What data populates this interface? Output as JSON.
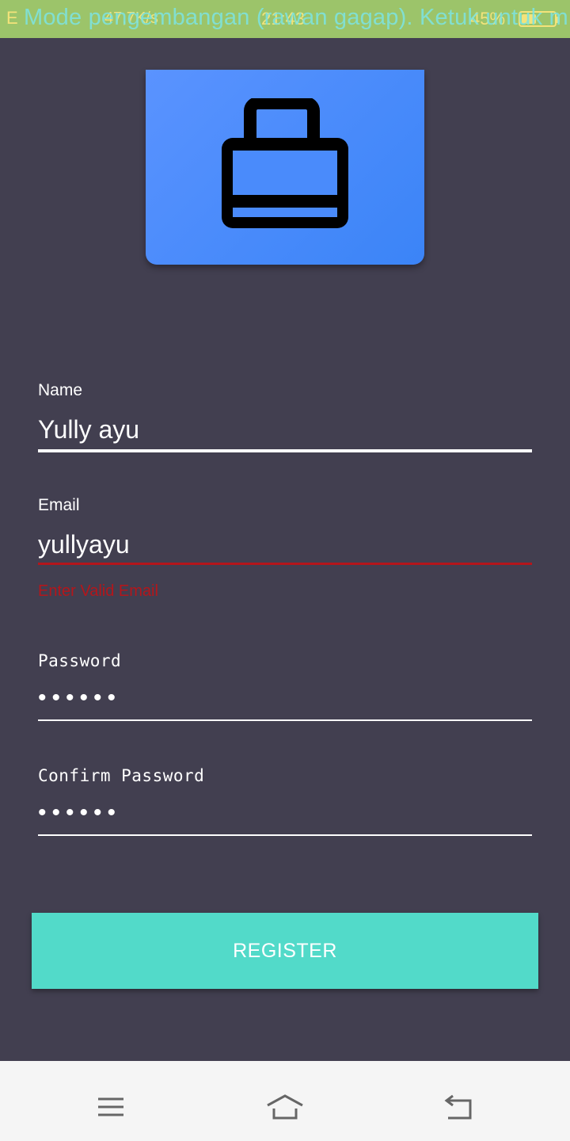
{
  "status_bar": {
    "left_text": "E",
    "network_speed": "47,7K/s",
    "time": "21:43",
    "battery_percent": "45%",
    "battery_level": 0.45,
    "dev_banner": "Mode pengembangan (rawan gagap). Ketuk untuk m..."
  },
  "logo": {
    "icon": "briefcase-icon",
    "color": "#3b84f7"
  },
  "form": {
    "name": {
      "label": "Name",
      "value": "Yully ayu"
    },
    "email": {
      "label": "Email",
      "value": "yullyayu",
      "error": "Enter Valid Email"
    },
    "password": {
      "label": "Password",
      "value": "••••••"
    },
    "confirm_password": {
      "label": "Confirm Password",
      "value": "••••••"
    }
  },
  "register_button": {
    "label": "REGISTER",
    "color": "#52dac9"
  },
  "colors": {
    "background": "#423f50",
    "error": "#b4161b",
    "status_bar": "#9cc46a"
  },
  "nav_bar": {
    "items": [
      "menu-icon",
      "home-icon",
      "back-icon"
    ]
  }
}
